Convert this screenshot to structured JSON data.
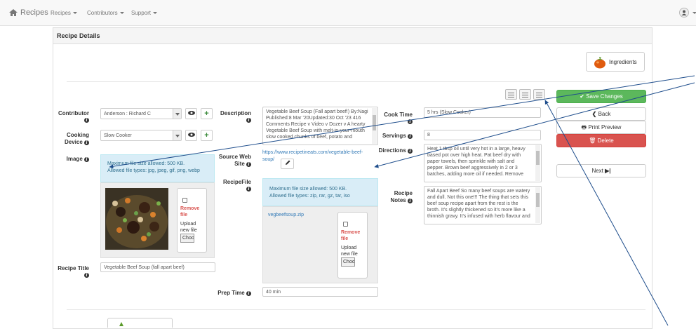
{
  "nav": {
    "brand": "Recipes",
    "menu": [
      "Recipes",
      "Contributors",
      "Support"
    ]
  },
  "panel": {
    "title": "Recipe Details"
  },
  "ingredients_button": "Ingredients",
  "contributor": {
    "label": "Contributor",
    "value": "Anderson : Richard C"
  },
  "cooking_device": {
    "label_line1": "Cooking",
    "label_line2": "Device",
    "value": "Slow Cooker"
  },
  "image": {
    "label": "Image",
    "info_line1": "Maximum file size allowed: 500 KB.",
    "info_line2": "Allowed file types: jpg, jpeg, gif, png, webp",
    "remove_line1": "Remove",
    "remove_line2": "file",
    "upload_line1": "Upload",
    "upload_line2": "new file",
    "choose": "Choose File"
  },
  "recipe_title": {
    "label": "Recipe Title",
    "value": "Vegetable Beef Soup (fall apart beef)"
  },
  "description": {
    "label": "Description",
    "lines": [
      "Vegetable Beef Soup (Fall apart beef!) By:Nagi",
      "Published:8 Mar '20Updated:30 Oct '23 416",
      "Comments Recipe v Video v Dozer v A hearty",
      "Vegetable Beef Soup with melt-in-your-mouth",
      "slow cooked chunks of beef, potato and"
    ]
  },
  "source_web_site": {
    "label_line1": "Source Web",
    "label_line2": "Site",
    "url_line1": "https://www.recipetineats.com/vegetable-beef-",
    "url_line2": "soup/"
  },
  "recipe_file": {
    "label": "RecipeFile",
    "info_line1": "Maximum file size allowed: 500 KB.",
    "info_line2": "Allowed file types: zip, rar, gz, tar, iso",
    "filename": "vegbeefsoup.zip",
    "remove_line1": "Remove",
    "remove_line2": "file",
    "upload_line1": "Upload",
    "upload_line2": "new file",
    "choose": "Choose File"
  },
  "prep_time": {
    "label": "Prep Time",
    "value": "40 min"
  },
  "cook_time": {
    "label": "Cook Time",
    "value": "5 hrs (Slow Cooker)"
  },
  "servings": {
    "label": "Servings",
    "value": "8"
  },
  "directions": {
    "label": "Directions",
    "lines": [
      "Heat 1 tbsp oil until very hot in a large, heavy",
      "based pot over high heat.    Pat beef dry with",
      "paper towels, then sprinkle with salt and",
      "pepper.    Brown beef aggressively in 2 or 3",
      "batches, adding more oil if needed. Remove"
    ]
  },
  "recipe_notes": {
    "label_line1": "Recipe",
    "label_line2": "Notes",
    "lines": [
      "Fall Apart Beef So many beef soups are watery",
      "and dull. Not this one!!! The thing that sets this",
      "beef soup recipe apart from the rest is the",
      "broth. It's slightly thickened so it's more like a",
      "thinnish gravy. It's infused with herb flavour and"
    ]
  },
  "actions": {
    "save": "Save Changes",
    "back": "Back",
    "print": "Print Preview",
    "delete": "Delete",
    "next": "Next"
  },
  "colors": {
    "save": "#5cb85c",
    "delete": "#d9534f",
    "link": "#337ab7",
    "arrow": "#1f4e8c"
  }
}
